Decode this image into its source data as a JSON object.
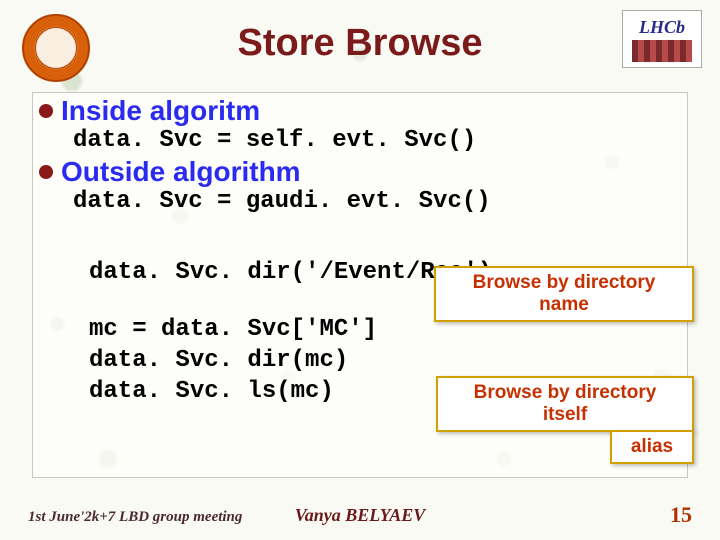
{
  "title": "Store Browse",
  "logos": {
    "lhcb_text": "LHCb"
  },
  "bullets": {
    "inside": {
      "label": "Inside algoritm",
      "code": "data. Svc = self. evt. Svc()"
    },
    "outside": {
      "label": "Outside algorithm",
      "code": "data. Svc = gaudi. evt. Svc()"
    }
  },
  "example": {
    "line1": "data. Svc. dir('/Event/Rec')",
    "line2": "mc = data. Svc['MC']",
    "line3": "data. Svc. dir(mc)",
    "line4": "data. Svc. ls(mc)"
  },
  "notes": {
    "byname": "Browse by directory name",
    "byself": "Browse by directory itself",
    "alias": "alias"
  },
  "footer": {
    "left": "1st June'2k+7  LBD group meeting",
    "center": "Vanya  BELYAEV",
    "page": "15"
  }
}
